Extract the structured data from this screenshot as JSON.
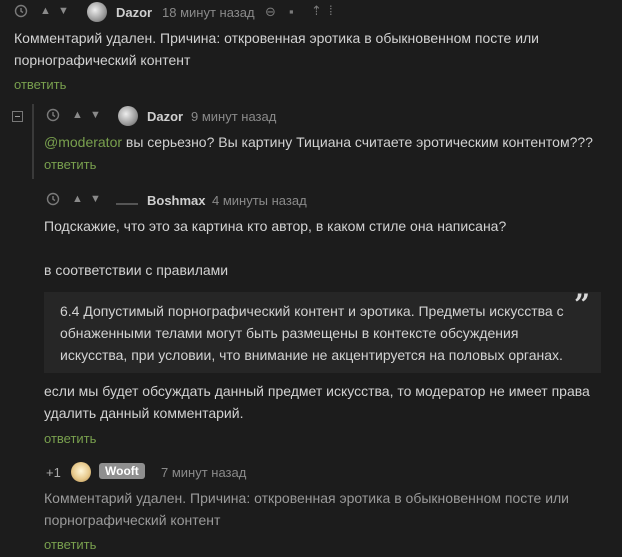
{
  "comments": [
    {
      "author": "Dazor",
      "time": "18 минут назад",
      "text": "Комментарий удален. Причина: откровенная эротика в обыкновенном посте или порнографический контент",
      "reply": "ответить"
    },
    {
      "author": "Dazor",
      "time": "9 минут назад",
      "mention": "@moderator",
      "text": " вы серьезно? Вы картину Тициана считаете эротическим контентом???",
      "reply": "ответить"
    },
    {
      "author": "Boshmax",
      "time": "4 минуты назад",
      "p1": "Подскажие, что это за картина кто автор, в каком стиле она написана?",
      "p2": "в соответствии с правилами",
      "quote_l1": "6.4 Допустимый порнографический контент и эротика. Предметы искусства с",
      "quote_l2": "обнаженными телами могут быть размещены в контексте обсуждения",
      "quote_l3": "искусства, при условии, что внимание не акцентируется на половых органах.",
      "p3_l1": "если мы будет обсуждать данный предмет искусства, то модератор не имеет права",
      "p3_l2": "удалить данный комментарий.",
      "reply": "ответить"
    },
    {
      "rating": "+1",
      "author": "Wooft",
      "time": "7 минут назад",
      "text_l1": "Комментарий удален. Причина: откровенная эротика в обыкновенном посте или",
      "text_l2": "порнографический контент",
      "reply": "ответить"
    }
  ],
  "icons": {
    "clock": "clock-icon",
    "vote_up": "arrow-up-icon",
    "vote_down": "arrow-down-icon",
    "link": "link-icon",
    "save": "save-icon",
    "share": "share-icon",
    "more": "more-icon",
    "quote": "quote-icon"
  },
  "colors": {
    "background": "#1c1c1c",
    "reply_link": "#79a04e",
    "mention": "#79a04e",
    "quote_bg": "#262626"
  }
}
